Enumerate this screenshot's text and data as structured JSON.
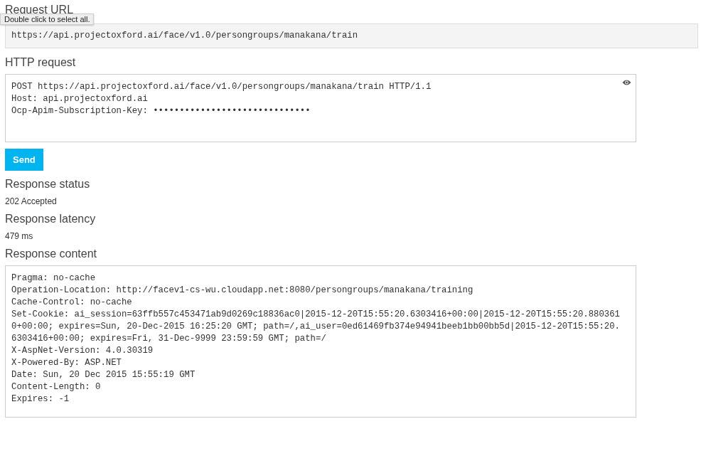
{
  "request_url": {
    "heading": "Request URL",
    "tooltip": "Double click to select all.",
    "value": "https://api.projectoxford.ai/face/v1.0/persongroups/manakana/train"
  },
  "http_request": {
    "heading": "HTTP request",
    "lines": [
      "POST https://api.projectoxford.ai/face/v1.0/persongroups/manakana/train HTTP/1.1",
      "Host: api.projectoxford.ai",
      "Ocp-Apim-Subscription-Key: ••••••••••••••••••••••••••••••"
    ]
  },
  "send_button": "Send",
  "response_status": {
    "heading": "Response status",
    "value": "202 Accepted"
  },
  "response_latency": {
    "heading": "Response latency",
    "value": "479 ms"
  },
  "response_content": {
    "heading": "Response content",
    "lines": [
      "Pragma: no-cache",
      "Operation-Location: http://facev1-cs-wu.cloudapp.net:8080/persongroups/manakana/training",
      "Cache-Control: no-cache",
      "Set-Cookie: ai_session=63ffb557c453471ab9d0269c18836ac0|2015-12-20T15:55:20.6303416+00:00|2015-12-20T15:55:20.8803610+00:00; expires=Sun, 20-Dec-2015 16:25:20 GMT; path=/,ai_user=0ed61469fb374e94941beeb1bb00bb5d|2015-12-20T15:55:20.6303416+00:00; expires=Fri, 31-Dec-9999 23:59:59 GMT; path=/",
      "X-AspNet-Version: 4.0.30319",
      "X-Powered-By: ASP.NET",
      "Date: Sun, 20 Dec 2015 15:55:19 GMT",
      "Content-Length: 0",
      "Expires: -1"
    ]
  }
}
